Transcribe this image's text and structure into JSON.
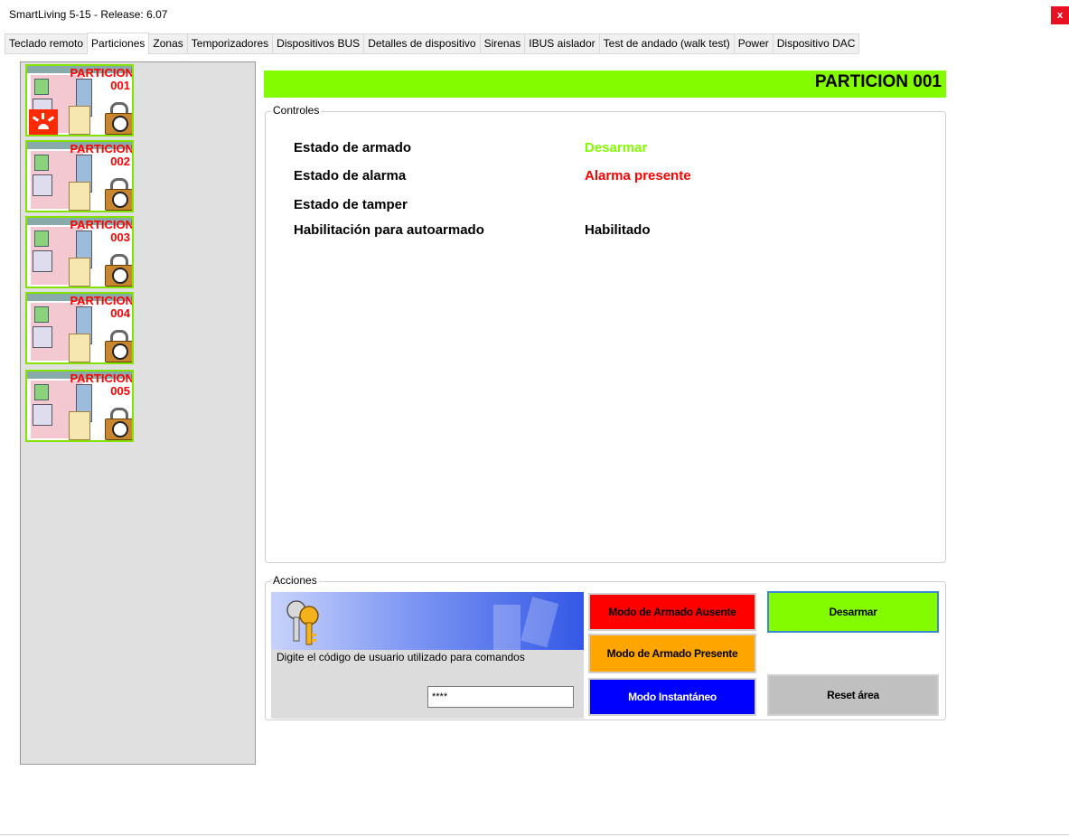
{
  "window": {
    "title": "SmartLiving 5-15 - Release: 6.07",
    "close_label": "x"
  },
  "tabs": [
    {
      "label": "Teclado remoto",
      "active": false
    },
    {
      "label": "Particiones",
      "active": true
    },
    {
      "label": "Zonas",
      "active": false
    },
    {
      "label": "Temporizadores",
      "active": false
    },
    {
      "label": "Dispositivos BUS",
      "active": false
    },
    {
      "label": "Detalles de dispositivo",
      "active": false
    },
    {
      "label": "Sirenas",
      "active": false
    },
    {
      "label": "IBUS aislador",
      "active": false
    },
    {
      "label": "Test de andado (walk test)",
      "active": false
    },
    {
      "label": "Power",
      "active": false
    },
    {
      "label": "Dispositivo DAC",
      "active": false
    }
  ],
  "partitions": [
    {
      "label": "PARTICION",
      "number": "001",
      "alarm": true
    },
    {
      "label": "PARTICION",
      "number": "002",
      "alarm": false
    },
    {
      "label": "PARTICION",
      "number": "003",
      "alarm": false
    },
    {
      "label": "PARTICION",
      "number": "004",
      "alarm": false
    },
    {
      "label": "PARTICION",
      "number": "005",
      "alarm": false
    }
  ],
  "header": {
    "title": "PARTICION  001",
    "color": "#83fc00"
  },
  "controles": {
    "legend": "Controles",
    "rows": [
      {
        "label": "Estado de armado",
        "value": "Desarmar",
        "color": "#83fc00"
      },
      {
        "label": "Estado de alarma",
        "value": "Alarma presente",
        "color": "#ff0000"
      },
      {
        "label": "Estado de tamper",
        "value": "",
        "color": "#000000"
      },
      {
        "label": "Habilitación para autoarmado",
        "value": "Habilitado",
        "color": "#000000"
      }
    ]
  },
  "acciones": {
    "legend": "Acciones",
    "code_prompt": "Digite el código de usuario utilizado para comandos",
    "code_value": "****",
    "buttons": {
      "armado_ausente": {
        "label": "Modo de Armado Ausente",
        "color": "#ff0000"
      },
      "armado_presente": {
        "label": "Modo de Armado Presente",
        "color": "#ffa500"
      },
      "instantaneo": {
        "label": "Modo Instantáneo",
        "color": "#0000ff"
      },
      "desarmar": {
        "label": "Desarmar",
        "color": "#83fc00"
      },
      "reset_area": {
        "label": "Reset área",
        "color": "#c0c0c0"
      }
    }
  }
}
